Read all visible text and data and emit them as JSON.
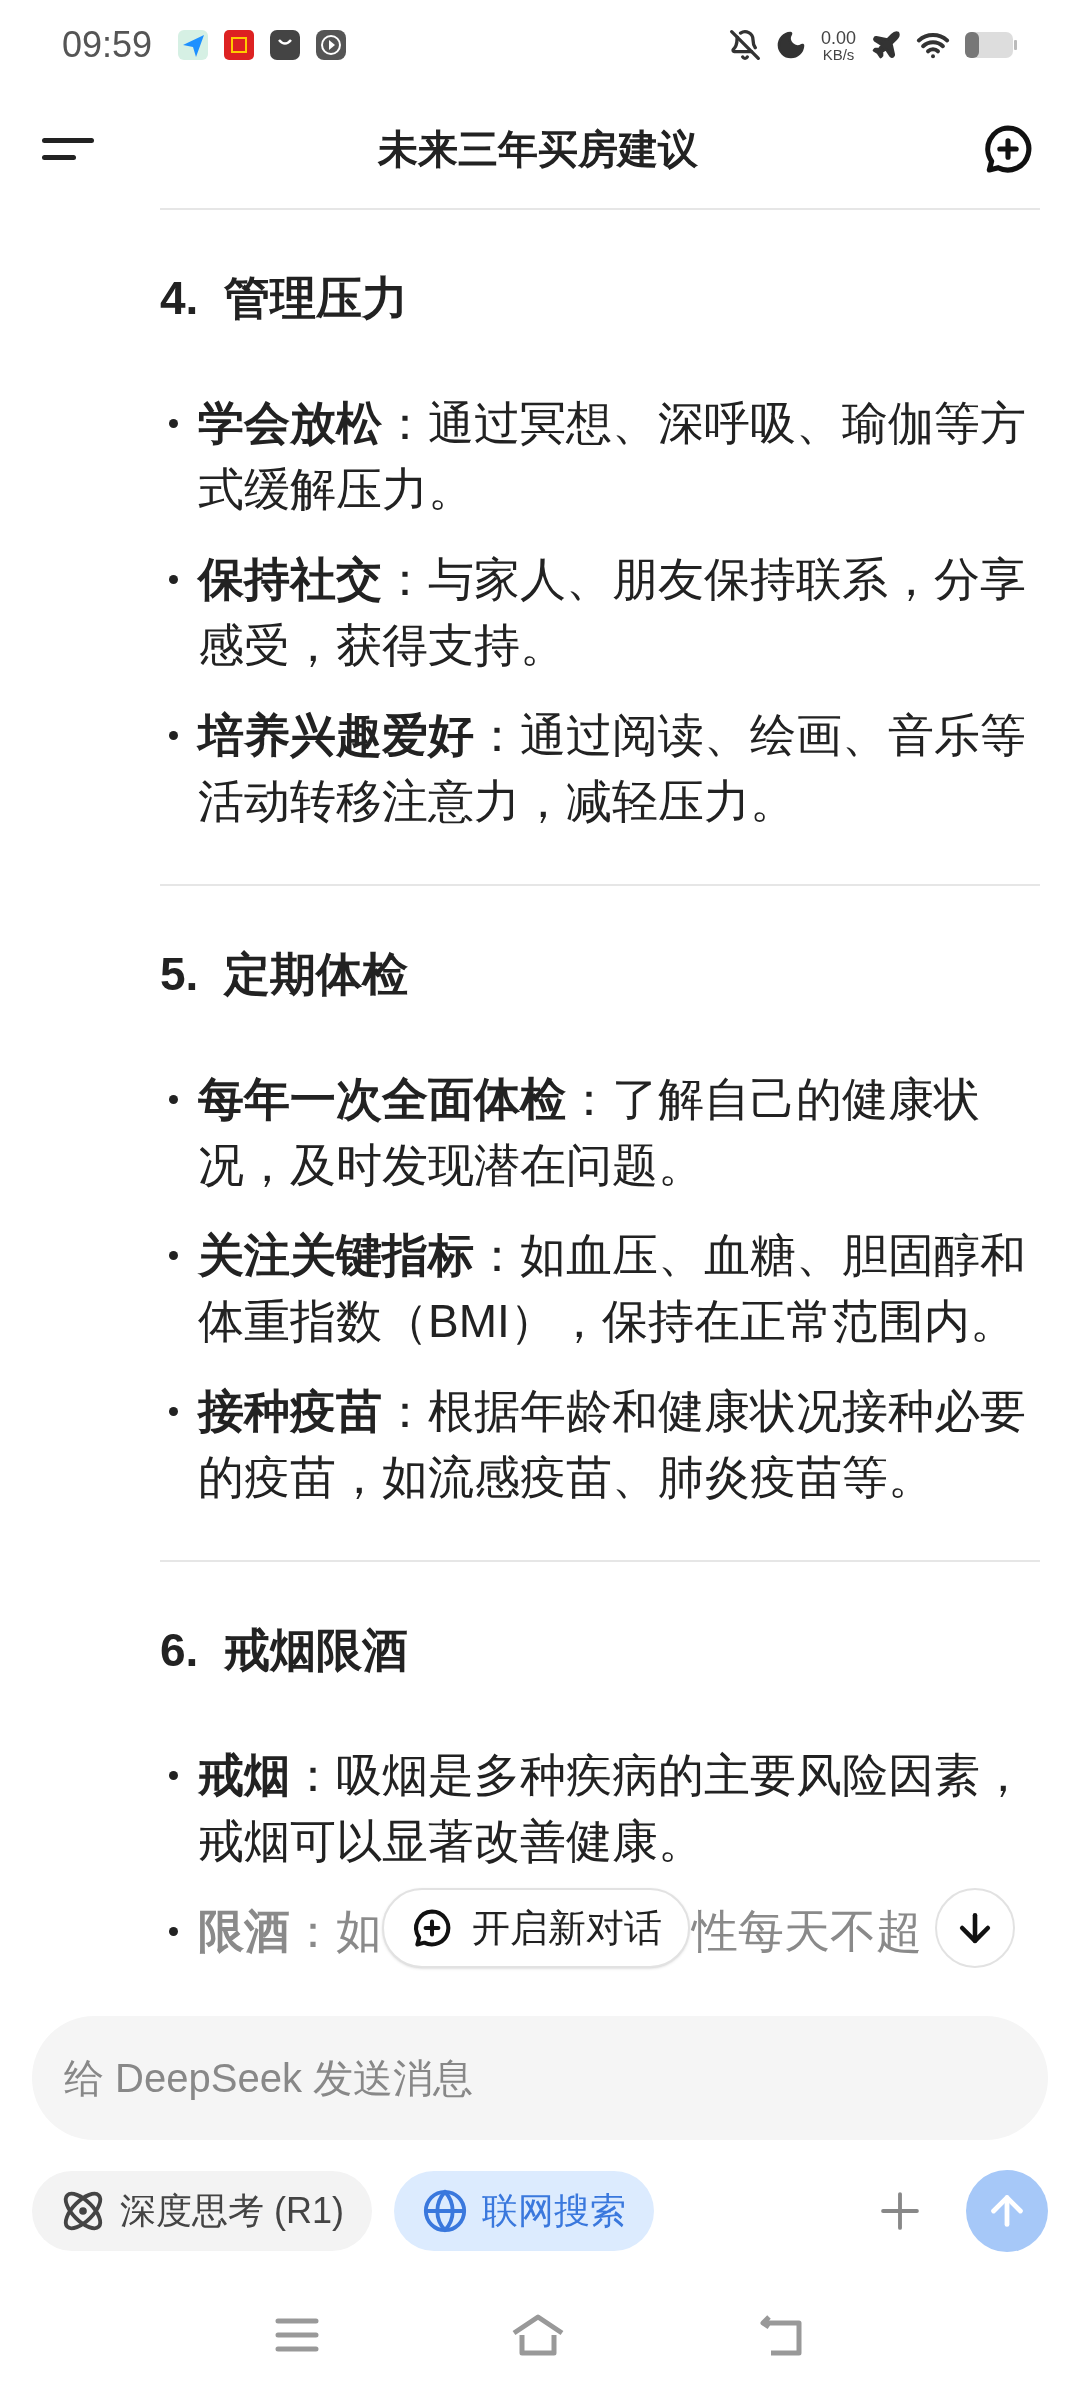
{
  "status_bar": {
    "time": "09:59",
    "net_speed": "0.00",
    "net_unit": "KB/s"
  },
  "header": {
    "title": "未来三年买房建议"
  },
  "sections": [
    {
      "heading": "4.  管理压力",
      "items": [
        {
          "text": "**学会放松**：通过冥想、深呼吸、瑜伽等方式缓解压力。"
        },
        {
          "text": "**保持社交**：与家人、朋友保持联系，分享感受，获得支持。"
        },
        {
          "text": "**培养兴趣爱好**：通过阅读、绘画、音乐等活动转移注意力，减轻压力。"
        }
      ]
    },
    {
      "heading": "5.  定期体检",
      "items": [
        {
          "text": "**每年一次全面体检**：了解自己的健康状况，及时发现潜在问题。"
        },
        {
          "text": "**关注关键指标**：如血压、血糖、胆固醇和体重指数（BMI），保持在正常范围内。"
        },
        {
          "text": "**接种疫苗**：根据年龄和健康状况接种必要的疫苗，如流感疫苗、肺炎疫苗等。"
        }
      ]
    },
    {
      "heading": "6.  戒烟限酒",
      "items": [
        {
          "text": "**戒烟**：吸烟是多种疾病的主要风险因素，戒烟可以显著改善健康。"
        },
        {
          "text": "**限酒**：如",
          "text_after": "性每天不超"
        }
      ]
    }
  ],
  "new_chat_button": {
    "label": "开启新对话"
  },
  "composer": {
    "placeholder": "给 DeepSeek 发送消息"
  },
  "toggles": [
    {
      "kind": "think",
      "label": "深度思考 (R1)",
      "selected": false
    },
    {
      "kind": "search",
      "label": "联网搜索",
      "selected": true
    }
  ],
  "send_button": {
    "disabled": true
  }
}
